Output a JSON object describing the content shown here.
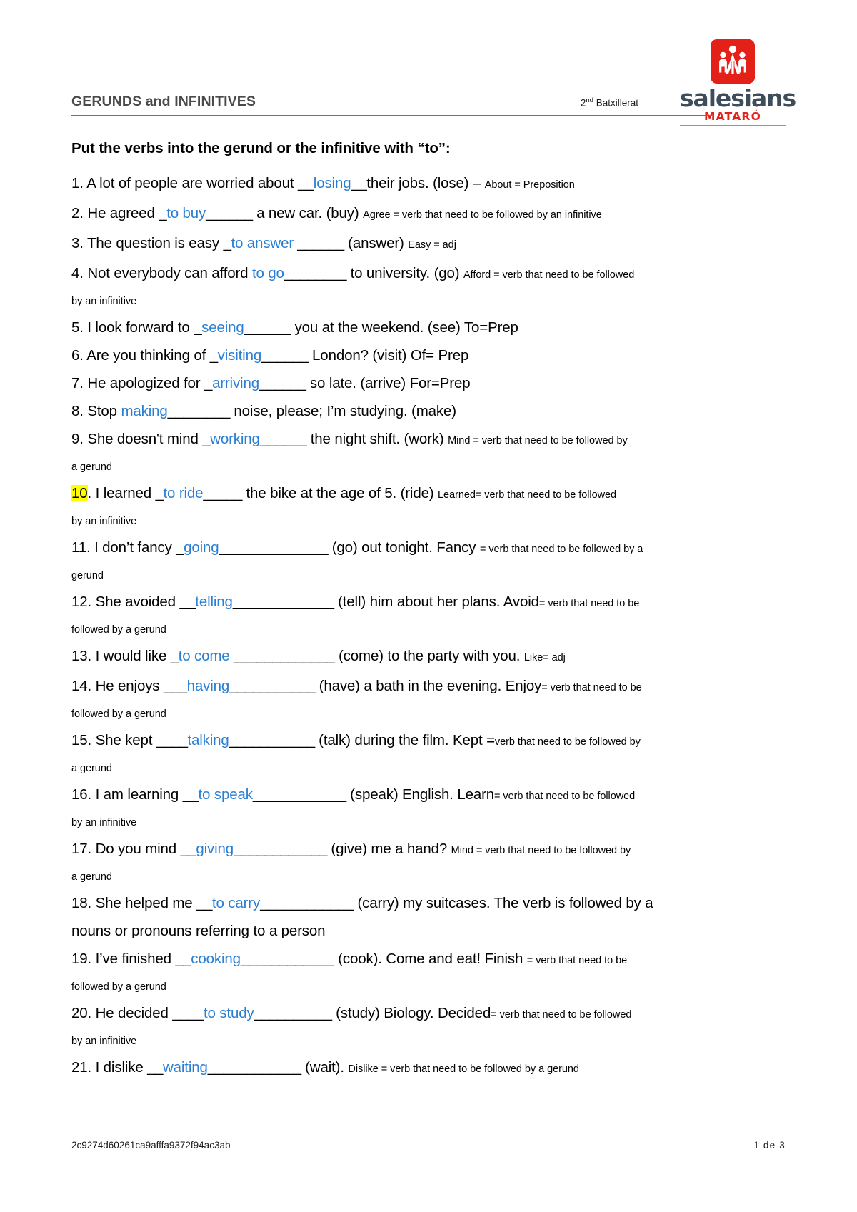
{
  "header": {
    "title": "GERUNDS and INFINITIVES",
    "course_prefix": "2",
    "course_sup": "nd",
    "course_suffix": " Batxillerat",
    "accent_color": "#e8413a"
  },
  "logo": {
    "icon": "salesians-three-figures-icon",
    "wordmark": "salesians",
    "location": "MATARÓ",
    "mark_color": "#e32119",
    "word_color": "#3d4d5c",
    "rule_color": "#ef7c22"
  },
  "main": {
    "instruction": "Put the verbs into the gerund or the infinitive with “to”:",
    "answer_color": "#2a7fd4",
    "highlight_color": "#ffff00",
    "items": [
      {
        "number": "1. ",
        "pre": "A lot of people are worried about ",
        "blank_pre": "__",
        "answer": "losing",
        "blank_post": "__",
        "post": "their jobs. (lose) – ",
        "note": "About = Preposition",
        "continuation": ""
      },
      {
        "number": "2. ",
        "pre": "He agreed ",
        "blank_pre": "_",
        "answer": "to buy",
        "blank_post": "______",
        "post": " a new car. (buy) ",
        "note": "Agree = verb that need to be followed by an infinitive",
        "continuation": ""
      },
      {
        "number": "3. ",
        "pre": "The question is easy ",
        "blank_pre": "_",
        "answer": "to answer",
        "blank_post": " ______",
        "post": " (answer) ",
        "note": "Easy = adj",
        "continuation": ""
      },
      {
        "number": "4. ",
        "pre": "Not everybody can afford ",
        "blank_pre": "",
        "answer": "to go",
        "blank_post": "________",
        "post": " to university. (go) ",
        "note": "Afford = verb that need to be followed",
        "continuation": "by an infinitive"
      },
      {
        "number": "5. ",
        "pre": "I look forward to ",
        "blank_pre": "_",
        "answer": "seeing",
        "blank_post": "______",
        "post": " you at the weekend. (see) To=Prep",
        "note": "",
        "continuation": ""
      },
      {
        "number": "6. ",
        "pre": "Are you thinking of ",
        "blank_pre": "_",
        "answer": "visiting",
        "blank_post": "______",
        "post": " London? (visit) Of= Prep",
        "note": "",
        "continuation": ""
      },
      {
        "number": "7. ",
        "pre": "He apologized for ",
        "blank_pre": "_",
        "answer": "arriving",
        "blank_post": "______",
        "post": " so late. (arrive) For=Prep",
        "note": "",
        "continuation": ""
      },
      {
        "number": "8. ",
        "pre": "Stop ",
        "blank_pre": "",
        "answer": "making",
        "blank_post": "________",
        "post": " noise, please; I’m studying. (make)",
        "note": "",
        "continuation": ""
      },
      {
        "number": "9. ",
        "pre": "She doesn't mind ",
        "blank_pre": "_",
        "answer": "working",
        "blank_post": "______",
        "post": " the night shift. (work) ",
        "note": "Mind = verb that need to be followed by",
        "continuation": "a gerund"
      },
      {
        "number": "10",
        "number_highlighted": true,
        "pre": ".  I learned ",
        "blank_pre": "_",
        "answer": "to ride",
        "blank_post": "_____",
        "post": "  the bike at the age of 5. (ride) ",
        "note": "Learned= verb that need to be followed",
        "continuation": "by an infinitive"
      },
      {
        "number": "11. ",
        "pre": "I don’t fancy ",
        "blank_pre": "_",
        "answer": "going",
        "blank_post": "______________",
        "post": " (go) out tonight. Fancy ",
        "note": "= verb that need to be followed by a",
        "continuation": "gerund"
      },
      {
        "number": "12. ",
        "pre": "She avoided ",
        "blank_pre": "__",
        "answer": "telling",
        "blank_post": "_____________",
        "post": " (tell) him about her plans. Avoid",
        "note": "= verb that need to be",
        "continuation": "followed by a gerund"
      },
      {
        "number": "13. ",
        "pre": "I would like ",
        "blank_pre": "_",
        "answer": "to come",
        "blank_post": " _____________",
        "post": " (come) to the party with you. ",
        "note": "Like= adj",
        "continuation": ""
      },
      {
        "number": "14. ",
        "pre": "He enjoys ",
        "blank_pre": "___",
        "answer": "having",
        "blank_post": "___________",
        "post": " (have) a bath in the evening. Enjoy",
        "note": "= verb that need to be",
        "continuation": "followed by a gerund"
      },
      {
        "number": "15. ",
        "pre": "She kept ",
        "blank_pre": "____",
        "answer": "talking",
        "blank_post": "___________",
        "post": " (talk) during the film. Kept =",
        "note": "verb that need to be followed by",
        "continuation": "a gerund"
      },
      {
        "number": "16. ",
        "pre": "I am learning ",
        "blank_pre": "__",
        "answer": "to speak",
        "blank_post": "____________",
        "post": " (speak) English. Learn",
        "note": "= verb that need to be followed",
        "continuation": "by an infinitive"
      },
      {
        "number": "17. ",
        "pre": "Do you mind ",
        "blank_pre": "__",
        "answer": "giving",
        "blank_post": "____________",
        "post": " (give) me a hand? ",
        "note": "Mind = verb that need to be followed by",
        "continuation": "a gerund"
      },
      {
        "number": "18. ",
        "pre": "She helped me ",
        "blank_pre": "__",
        "answer": "to carry",
        "blank_post": "____________",
        "post": " (carry) my suitcases. The verb is followed by a",
        "note": "",
        "continuation_big": "nouns or pronouns referring to a person"
      },
      {
        "number": "19. ",
        "pre": "I’ve finished ",
        "blank_pre": "__",
        "answer": "cooking",
        "blank_post": "____________",
        "post": " (cook). Come and eat! Finish ",
        "note": "= verb that need to be",
        "continuation": "followed by a gerund"
      },
      {
        "number": "20. ",
        "pre": "He decided ",
        "blank_pre": "____",
        "answer": "to study",
        "blank_post": "__________",
        "post": " (study) Biology.  Decided",
        "note": "= verb that need to be followed",
        "continuation": "by an infinitive"
      },
      {
        "number": "21. ",
        "pre": "I dislike ",
        "blank_pre": "__",
        "answer": "waiting",
        "blank_post": "____________",
        "post": " (wait). ",
        "note": "Dislike = verb that need to be followed by a gerund",
        "continuation": ""
      }
    ]
  },
  "footer": {
    "doc_id": "2c9274d60261ca9afffa9372f94ac3ab",
    "page_label": "1  de  3"
  }
}
